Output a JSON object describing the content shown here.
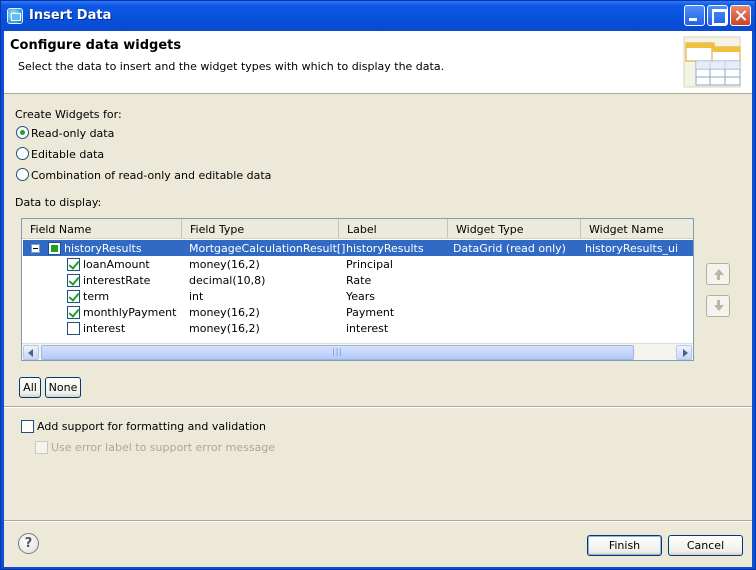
{
  "window": {
    "title": "Insert Data"
  },
  "banner": {
    "title": "Configure data widgets",
    "description": "Select the data to insert and the widget types with which to display the data."
  },
  "create_widgets": {
    "label": "Create Widgets for:",
    "options": [
      {
        "label": "Read-only data",
        "selected": true
      },
      {
        "label": "Editable data",
        "selected": false
      },
      {
        "label": "Combination of read-only and editable data",
        "selected": false
      }
    ]
  },
  "data_display": {
    "label": "Data to display:",
    "columns": [
      "Field Name",
      "Field Type",
      "Label",
      "Widget Type",
      "Widget Name"
    ],
    "rows": [
      {
        "field_name": "historyResults",
        "field_type": "MortgageCalculationResult[]",
        "label": "historyResults",
        "widget_type": "DataGrid (read only)",
        "widget_name": "historyResults_ui",
        "checked": "partial",
        "expanded": true,
        "selected": true
      },
      {
        "field_name": "loanAmount",
        "field_type": "money(16,2)",
        "label": "Principal",
        "widget_type": "",
        "widget_name": "",
        "checked": true
      },
      {
        "field_name": "interestRate",
        "field_type": "decimal(10,8)",
        "label": "Rate",
        "widget_type": "",
        "widget_name": "",
        "checked": true
      },
      {
        "field_name": "term",
        "field_type": "int",
        "label": "Years",
        "widget_type": "",
        "widget_name": "",
        "checked": true
      },
      {
        "field_name": "monthlyPayment",
        "field_type": "money(16,2)",
        "label": "Payment",
        "widget_type": "",
        "widget_name": "",
        "checked": true
      },
      {
        "field_name": "interest",
        "field_type": "money(16,2)",
        "label": "interest",
        "widget_type": "",
        "widget_name": "",
        "checked": false
      }
    ]
  },
  "select_buttons": {
    "all": "All",
    "none": "None"
  },
  "options": {
    "formatting": {
      "label": "Add support for formatting and validation",
      "checked": false
    },
    "error_label": {
      "label": "Use error label to support error message",
      "checked": false,
      "enabled": false
    }
  },
  "footer": {
    "help": "?",
    "finish": "Finish",
    "cancel": "Cancel"
  }
}
